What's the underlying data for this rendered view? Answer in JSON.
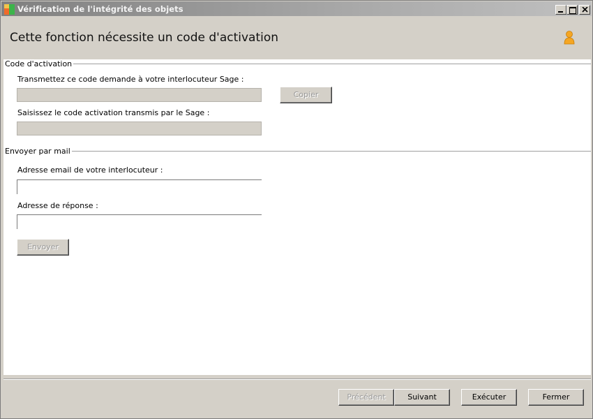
{
  "window": {
    "title": "Vérification de l'intégrité des objets"
  },
  "header": {
    "title": "Cette fonction nécessite un code d'activation"
  },
  "activation": {
    "group_title": "Code d'activation",
    "transmit_label": "Transmettez ce code demande à votre interlocuteur Sage :",
    "transmit_value": "",
    "copy_button": "Copier",
    "enter_label": "Saisissez le code activation transmis par le Sage :",
    "enter_value": ""
  },
  "mail": {
    "group_title": "Envoyer par mail",
    "email_label": "Adresse email de votre interlocuteur :",
    "email_value": "",
    "reply_label": "Adresse de réponse :",
    "reply_value": "",
    "send_button": "Envoyer"
  },
  "footer": {
    "previous": "Précédent",
    "next": "Suivant",
    "execute": "Exécuter",
    "close": "Fermer"
  },
  "icons": {
    "app": "app-logo-icon",
    "user": "user-icon",
    "minimize": "minimize-icon",
    "maximize": "maximize-icon",
    "close": "close-icon"
  }
}
